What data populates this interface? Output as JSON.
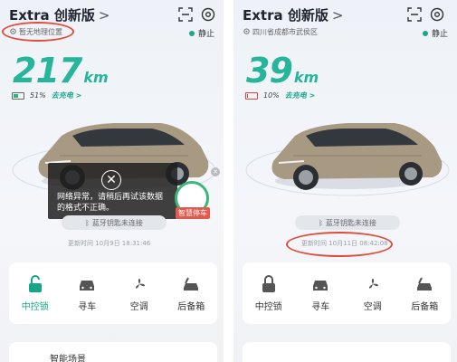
{
  "left": {
    "title": "Extra 创新版",
    "chevron": ">",
    "location": "暂无地理位置",
    "status": "静止",
    "range_value": "217",
    "range_unit": "km",
    "battery_pct": "51%",
    "battery_level": 0.51,
    "charge_link": "去充电 >",
    "toast_text": "网络异常，请稍后再试该数据的格式不正确。",
    "park_label": "智慧停车",
    "bt_text": "蓝牙钥匙未连接",
    "updated_text": "更新时间 10月9日 18:31:46",
    "controls": [
      {
        "label": "中控锁",
        "icon": "unlock-icon",
        "active": true
      },
      {
        "label": "寻车",
        "icon": "car-front-icon",
        "active": false
      },
      {
        "label": "空调",
        "icon": "fan-icon",
        "active": false
      },
      {
        "label": "后备箱",
        "icon": "trunk-icon",
        "active": false
      }
    ],
    "bottom_label": "智能场景"
  },
  "right": {
    "title": "Extra 创新版",
    "chevron": ">",
    "location": "四川省成都市武侯区",
    "status": "静止",
    "range_value": "39",
    "range_unit": "km",
    "battery_pct": "10%",
    "battery_level": 0.1,
    "charge_link": "去充电 >",
    "bt_text": "蓝牙钥匙未连接",
    "updated_text": "更新时间 10月11日 08:42:08",
    "controls": [
      {
        "label": "中控锁",
        "icon": "lock-icon",
        "active": false
      },
      {
        "label": "寻车",
        "icon": "car-front-icon",
        "active": false
      },
      {
        "label": "空调",
        "icon": "fan-icon",
        "active": false
      },
      {
        "label": "后备箱",
        "icon": "trunk-icon",
        "active": false
      }
    ]
  },
  "colors": {
    "accent": "#26b59a",
    "battery_ok": "#2bb673",
    "battery_low": "#e0453a",
    "annotation": "#e04b3a"
  }
}
